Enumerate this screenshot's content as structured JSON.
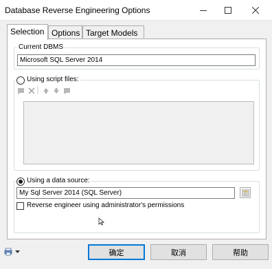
{
  "window": {
    "title": "Database Reverse Engineering Options"
  },
  "tabs": [
    {
      "label": "Selection",
      "active": true
    },
    {
      "label": "Options",
      "active": false
    },
    {
      "label": "Target Models",
      "active": false
    }
  ],
  "current_dbms": {
    "label": "Current DBMS",
    "value": "Microsoft SQL Server 2014"
  },
  "script_files": {
    "label": "Using script files:",
    "selected": false,
    "toolbar_icons": [
      "add-file-icon",
      "delete-icon",
      "move-up-icon",
      "move-down-icon",
      "open-file-icon"
    ]
  },
  "data_source": {
    "label": "Using a data source:",
    "selected": true,
    "value": "My Sql Server 2014 (SQL Server)",
    "admin_checkbox_label": "Reverse engineer using administrator's permissions",
    "admin_checked": false
  },
  "buttons": {
    "ok": "确定",
    "cancel": "取消",
    "help": "帮助"
  },
  "colors": {
    "accent": "#0078d7",
    "panel_bg": "#f0f0f0"
  }
}
